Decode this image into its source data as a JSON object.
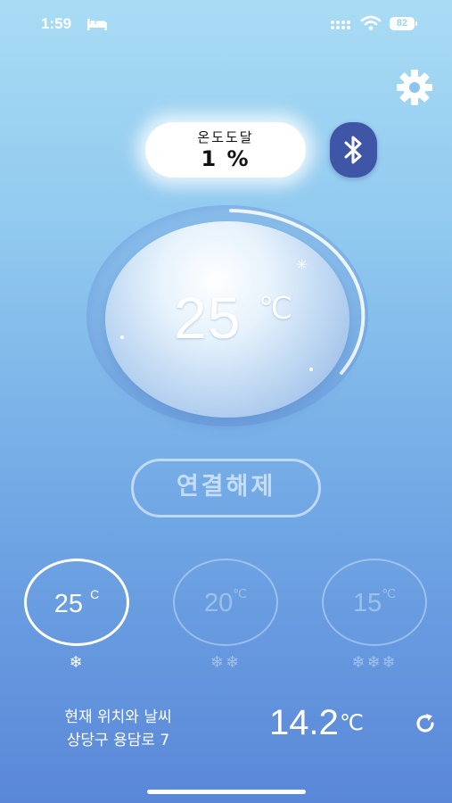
{
  "status_bar": {
    "time": "1:59",
    "battery": "82"
  },
  "reach": {
    "label": "온도도달",
    "value": "1 %"
  },
  "dial": {
    "temperature": "25",
    "unit": "℃"
  },
  "disconnect_label": "연결해제",
  "presets": [
    {
      "value": "25",
      "unit": "C",
      "flakes": "❄",
      "selected": true
    },
    {
      "value": "20",
      "unit": "℃",
      "flakes": "❄❄",
      "selected": false
    },
    {
      "value": "15",
      "unit": "℃",
      "flakes": "❄❄❄",
      "selected": false
    }
  ],
  "weather": {
    "title": "현재 위치와 날씨",
    "address": "상당구 용담로 7",
    "temperature": "14.2",
    "unit": "℃"
  },
  "icons": [
    "bed-icon",
    "signal-icon",
    "wifi-icon",
    "battery-icon",
    "gear-icon",
    "bluetooth-icon",
    "refresh-icon"
  ],
  "colors": {
    "bluetooth_button": "#3f55a6",
    "accent_white": "#ffffff"
  }
}
